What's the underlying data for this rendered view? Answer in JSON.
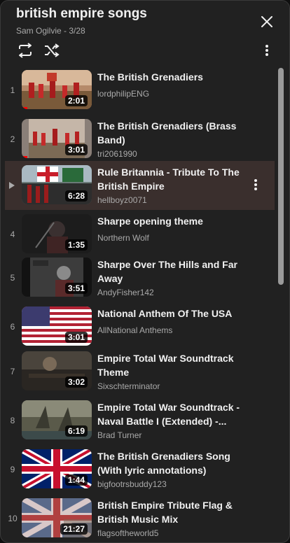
{
  "playlist": {
    "title": "british empire songs",
    "subtitle": "Sam Ogilvie - 3/28"
  },
  "icons": {
    "close": "close-icon",
    "loop": "loop-icon",
    "shuffle": "shuffle-icon",
    "more": "more-vert-icon"
  },
  "colors": {
    "panel": "#212121",
    "active_row": "#3a2f2d",
    "progress": "#ff0000",
    "secondary_text": "#aaaaaa"
  },
  "items": [
    {
      "index": "1",
      "title_line1": "The British Grenadiers",
      "title_line2": "",
      "channel": "lordphilipENG",
      "duration": "2:01",
      "watched": true
    },
    {
      "index": "2",
      "title_line1": "The British Grenadiers (Brass",
      "title_line2": "Band)",
      "channel": "tri2061990",
      "duration": "3:01",
      "watched": true
    },
    {
      "index": "",
      "title_line1": "Rule Britannia - Tribute To The",
      "title_line2": "British Empire",
      "channel": "hellboyz0071",
      "duration": "6:28",
      "watched": false,
      "playing": true
    },
    {
      "index": "4",
      "title_line1": "Sharpe opening theme",
      "title_line2": "",
      "channel": "Northern Wolf",
      "duration": "1:35",
      "watched": false
    },
    {
      "index": "5",
      "title_line1": "Sharpe Over The Hills and Far",
      "title_line2": "Away",
      "channel": "AndyFisher142",
      "duration": "3:51",
      "watched": false
    },
    {
      "index": "6",
      "title_line1": "National Anthem Of The USA",
      "title_line2": "",
      "channel": "AllNational Anthems",
      "duration": "3:01",
      "watched": false
    },
    {
      "index": "7",
      "title_line1": "Empire Total War Soundtrack",
      "title_line2": "Theme",
      "channel": "Sixschterminator",
      "duration": "3:02",
      "watched": false
    },
    {
      "index": "8",
      "title_line1": "Empire Total War Soundtrack -",
      "title_line2": "Naval Battle I (Extended) -...",
      "channel": "Brad Turner",
      "duration": "6:19",
      "watched": false
    },
    {
      "index": "9",
      "title_line1": "The British Grenadiers Song",
      "title_line2": "(With lyric annotations)",
      "channel": "bigfootrsbuddy123",
      "duration": "1:44",
      "watched": false
    },
    {
      "index": "10",
      "title_line1": "British Empire Tribute Flag &",
      "title_line2": "British Music Mix",
      "channel": "flagsoftheworld5",
      "duration": "21:27",
      "watched": false
    }
  ]
}
